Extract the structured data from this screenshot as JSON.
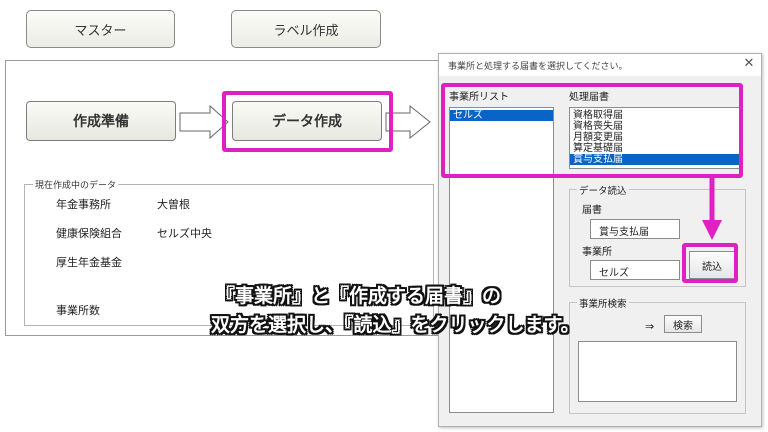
{
  "top_buttons": {
    "master": "マスター",
    "label_create": "ラベル作成"
  },
  "flow": {
    "prepare": "作成準備",
    "data_create": "データ作成"
  },
  "current_data": {
    "title": "現在作成中のデータ",
    "rows": [
      {
        "label": "年金事務所",
        "value": "大曽根"
      },
      {
        "label": "健康保険組合",
        "value": "セルズ中央"
      },
      {
        "label": "厚生年金基金",
        "value": ""
      },
      {
        "label": "事業所数",
        "value": ""
      }
    ]
  },
  "dialog": {
    "title": "事業所と処理する届書を選択してください。",
    "office_list_label": "事業所リスト",
    "office_items": [
      "セルズ"
    ],
    "selected_office_index": 0,
    "form_list_label": "処理届書",
    "form_items": [
      "資格取得届",
      "資格喪失届",
      "月額変更届",
      "算定基礎届",
      "賞与支払届"
    ],
    "selected_form_index": 4,
    "data_read": {
      "group_title": "データ読込",
      "form_label": "届書",
      "form_value": "賞与支払届",
      "office_label": "事業所",
      "office_value": "セルズ",
      "read_button": "読込"
    },
    "office_search": {
      "group_title": "事業所検索",
      "arrow": "⇒",
      "search_button": "検索"
    }
  },
  "caption": {
    "line1": "『事業所』と『作成する届書』の",
    "line2": "双方を選択し、『読込』をクリックします。"
  },
  "colors": {
    "highlight": "#e020c0",
    "selection": "#0a64c8"
  }
}
